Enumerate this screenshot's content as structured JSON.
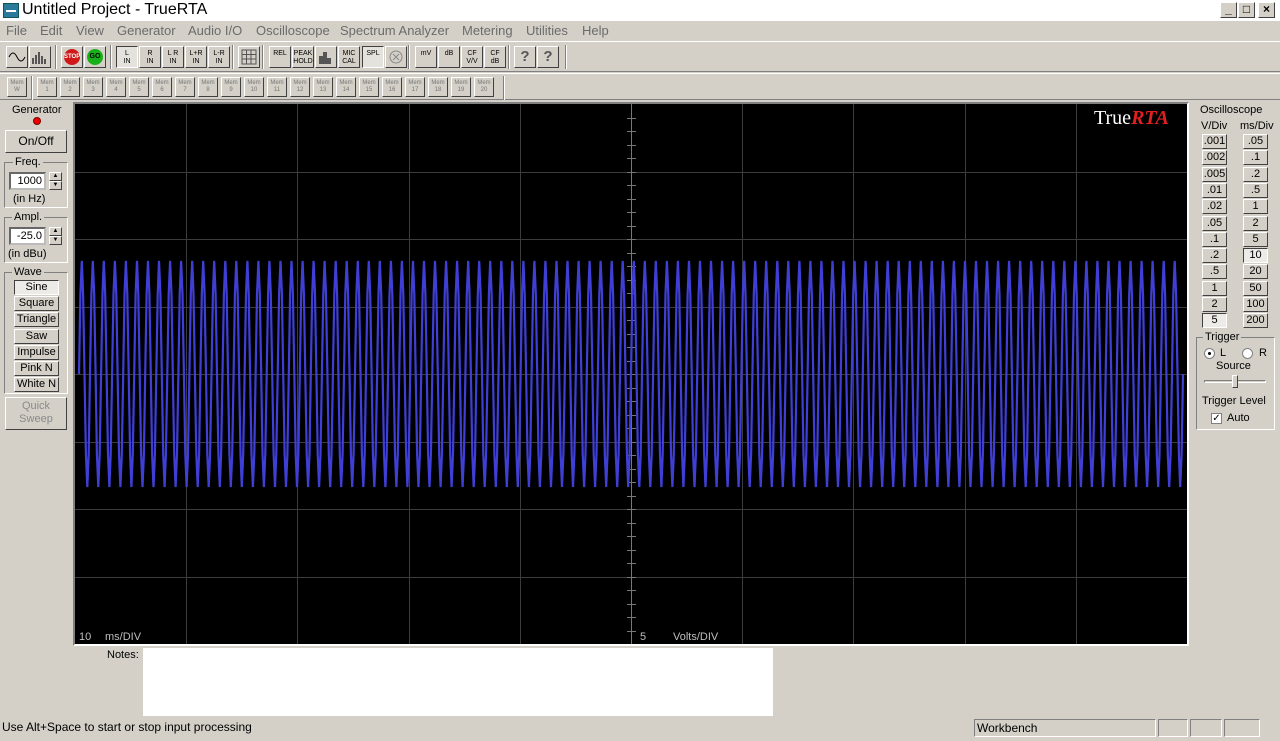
{
  "window": {
    "title": "Untitled Project - TrueRTA"
  },
  "menu": [
    "File",
    "Edit",
    "View",
    "Generator",
    "Audio I/O",
    "Oscilloscope",
    "Spectrum Analyzer",
    "Metering",
    "Utilities",
    "Help"
  ],
  "toolbar1": [
    {
      "name": "sine-wave-view-button",
      "label": ""
    },
    {
      "name": "rta-view-button",
      "label": ""
    },
    {
      "name": "stop-button",
      "label": "STOP"
    },
    {
      "name": "go-button",
      "label": "GO"
    },
    {
      "name": "l-in-button",
      "label": "L\nIN"
    },
    {
      "name": "r-in-button",
      "label": "R\nIN"
    },
    {
      "name": "lr-in-button",
      "label": "L R\nIN"
    },
    {
      "name": "lplusr-in-button",
      "label": "L+R\nIN"
    },
    {
      "name": "lminusr-in-button",
      "label": "L-R\nIN"
    },
    {
      "name": "grid-button",
      "label": ""
    },
    {
      "name": "rel-button",
      "label": "REL"
    },
    {
      "name": "peak-hold-button",
      "label": "PEAK\nHOLD"
    },
    {
      "name": "bar-graph-button",
      "label": ""
    },
    {
      "name": "mic-cal-button",
      "label": "MIC\nCAL"
    },
    {
      "name": "spl-button",
      "label": "SPL"
    },
    {
      "name": "weighting-button",
      "label": ""
    },
    {
      "name": "mv-button",
      "label": "mV"
    },
    {
      "name": "db-button",
      "label": "dB"
    },
    {
      "name": "cf-vv-button",
      "label": "CF\nV/V"
    },
    {
      "name": "cf-db-button",
      "label": "CF\ndB"
    },
    {
      "name": "help-button",
      "label": "?"
    },
    {
      "name": "context-help-button",
      "label": "?"
    }
  ],
  "toolbar2": {
    "items": [
      "Mem\nW",
      "Mem\n1",
      "Mem\n2",
      "Mem\n3",
      "Mem\n4",
      "Mem\n5",
      "Mem\n6",
      "Mem\n7",
      "Mem\n8",
      "Mem\n9",
      "Mem\n10",
      "Mem\n11",
      "Mem\n12",
      "Mem\n13",
      "Mem\n14",
      "Mem\n15",
      "Mem\n16",
      "Mem\n17",
      "Mem\n18",
      "Mem\n19",
      "Mem\n20"
    ]
  },
  "generator": {
    "title": "Generator",
    "onoff": "On/Off",
    "freq_label": "Freq.",
    "freq_value": "1000",
    "freq_unit": "(in Hz)",
    "ampl_label": "Ampl.",
    "ampl_value": "-25.0",
    "ampl_unit": "(in dBu)",
    "wave_label": "Wave",
    "waves": [
      "Sine",
      "Square",
      "Triangle",
      "Saw",
      "Impulse",
      "Pink N",
      "White N"
    ],
    "selected_wave": "Sine",
    "quick_sweep": "Quick\nSweep"
  },
  "oscilloscope": {
    "title": "Oscilloscope",
    "vdiv_label": "V/Div",
    "msdiv_label": "ms/Div",
    "vdiv": [
      ".001",
      ".002",
      ".005",
      ".01",
      ".02",
      ".05",
      ".1",
      ".2",
      ".5",
      "1",
      "2",
      "5"
    ],
    "msdiv": [
      ".05",
      ".1",
      ".2",
      ".5",
      "1",
      "2",
      "5",
      "10",
      "20",
      "50",
      "100",
      "200"
    ],
    "selected_vdiv": "5",
    "selected_msdiv": "10",
    "trigger_label": "Trigger",
    "source_l": "L",
    "source_r": "R",
    "source_label": "Source",
    "selected_source": "L",
    "trigger_level_label": "Trigger Level",
    "trigger_level": 0.5,
    "auto_label": "Auto",
    "auto_checked": true
  },
  "scope_display": {
    "logo_true": "True",
    "logo_rta": "RTA",
    "ms_div_value": "10",
    "ms_div_unit": "ms/DIV",
    "volts_div_value": "5",
    "volts_div_unit": "Volts/DIV",
    "trace_color": "#3f3fd6",
    "cycles": 100,
    "amplitude_divs": 2.5
  },
  "notes": {
    "label": "Notes:",
    "text": ""
  },
  "status": {
    "message": "Use Alt+Space to start or stop input processing",
    "mode": "Workbench"
  }
}
